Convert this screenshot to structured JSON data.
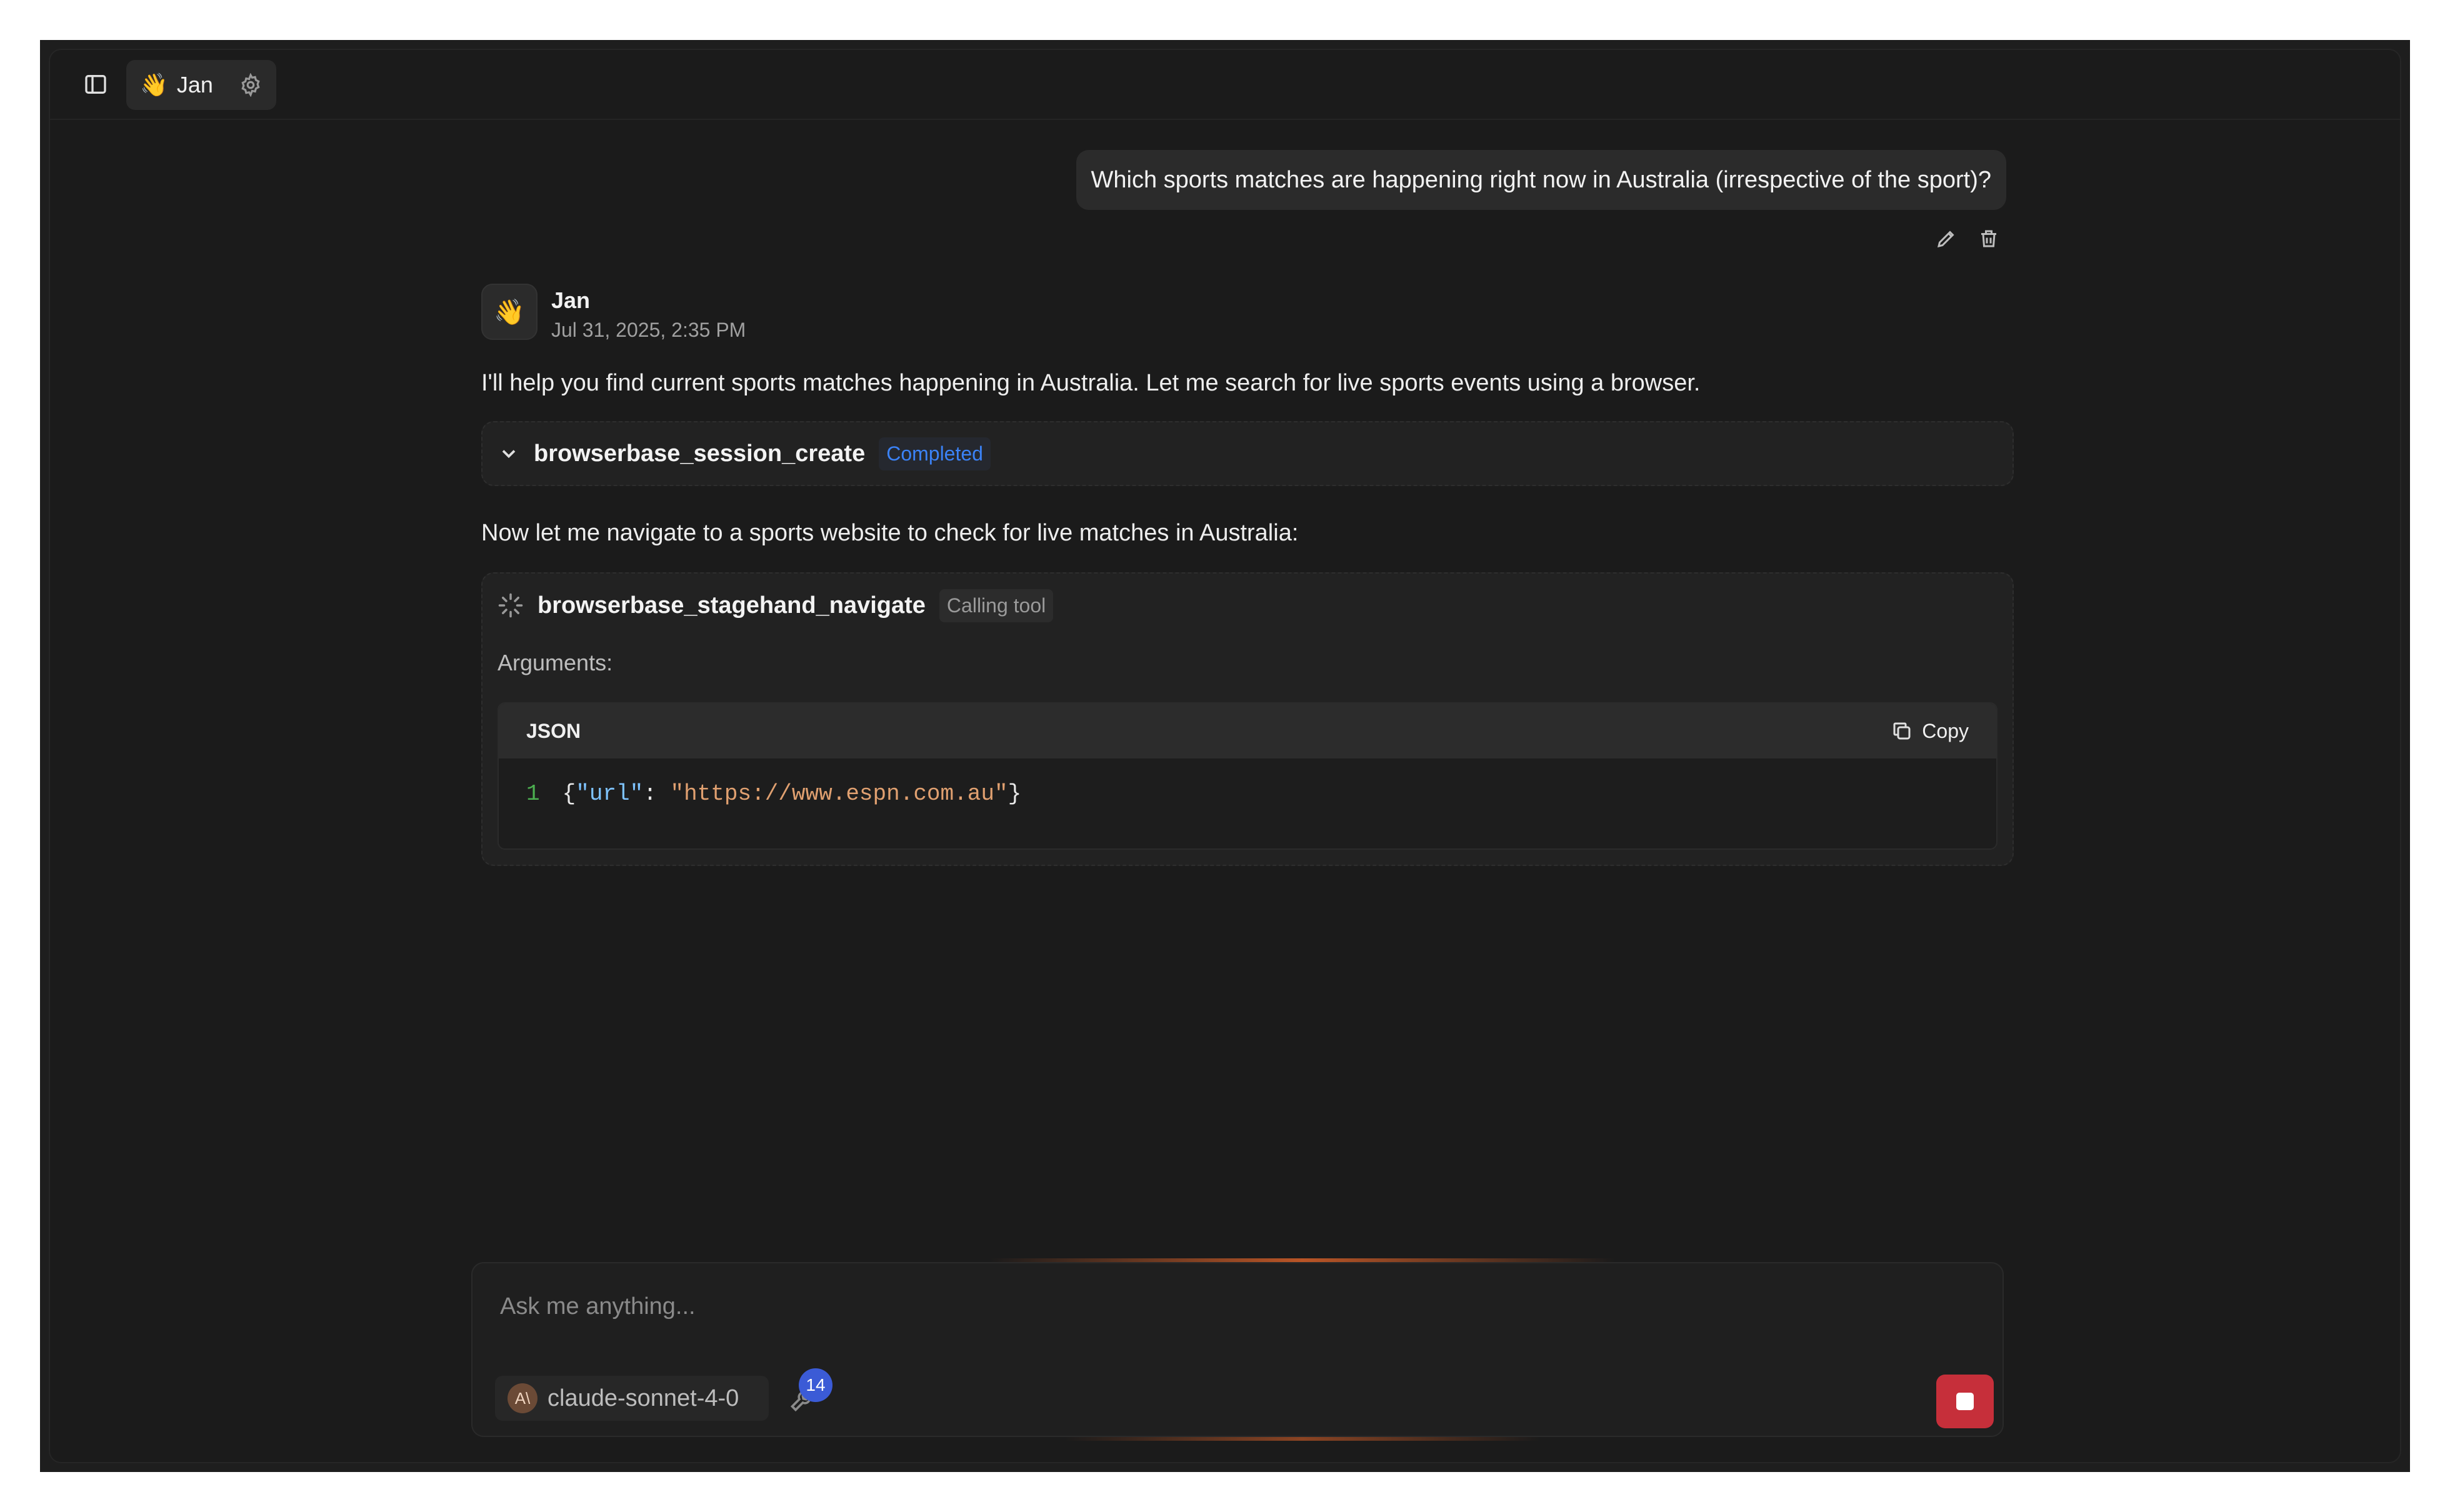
{
  "header": {
    "agent_emoji": "👋",
    "agent_name": "Jan"
  },
  "user_message": {
    "text": "Which sports matches are happening right now in Australia (irrespective of the sport)?"
  },
  "assistant": {
    "avatar_emoji": "👋",
    "name": "Jan",
    "timestamp": "Jul 31, 2025, 2:35 PM",
    "intro_text": "I'll help you find current sports matches happening in Australia. Let me search for live sports events using a browser.",
    "follow_text": "Now let me navigate to a sports website to check for live matches in Australia:"
  },
  "tool_calls": [
    {
      "name": "browserbase_session_create",
      "status": "Completed"
    },
    {
      "name": "browserbase_stagehand_navigate",
      "status": "Calling tool",
      "arguments_label": "Arguments:",
      "code": {
        "language": "JSON",
        "copy_label": "Copy",
        "line_number": "1",
        "key": "\"url\"",
        "value": "\"https://www.espn.com.au\""
      }
    }
  ],
  "composer": {
    "placeholder": "Ask me anything...",
    "model_logo_text": "A\\",
    "model_name": "claude-sonnet-4-0",
    "tools_count": "14"
  },
  "colors": {
    "completed": "#3b82f6",
    "stop": "#c62f3a",
    "tools_badge": "#3b5bd6"
  }
}
